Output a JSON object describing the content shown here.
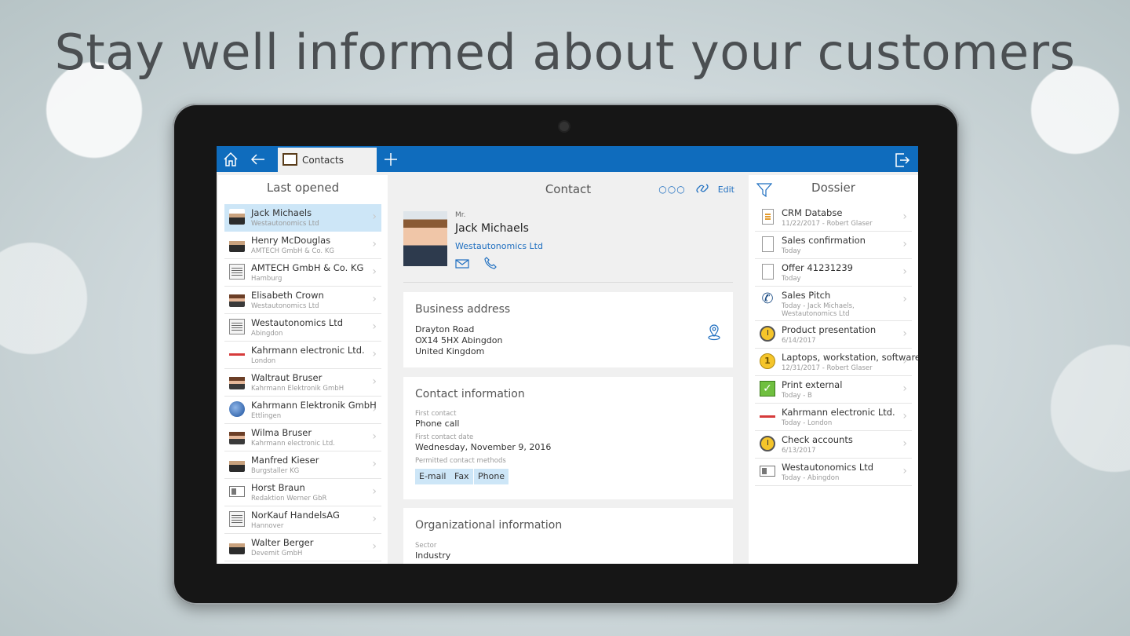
{
  "headline": "Stay well informed about your customers",
  "topbar": {
    "home_icon": "home-icon",
    "back_icon": "back-arrow-icon",
    "tab_label": "Contacts",
    "add_icon": "plus-icon",
    "exit_icon": "exit-icon",
    "accent": "#0f6cbd"
  },
  "last_opened": {
    "title": "Last opened",
    "items": [
      {
        "name": "Jack Michaels",
        "sub": "Westautonomics Ltd",
        "icon": "avatar-icon"
      },
      {
        "name": "Henry McDouglas",
        "sub": "AMTECH GmbH & Co. KG",
        "icon": "avatar-icon"
      },
      {
        "name": "AMTECH GmbH & Co. KG",
        "sub": "Hamburg",
        "icon": "building-icon"
      },
      {
        "name": "Elisabeth Crown",
        "sub": "Westautonomics Ltd",
        "icon": "avatar-icon"
      },
      {
        "name": "Westautonomics Ltd",
        "sub": "Abingdon",
        "icon": "building-icon"
      },
      {
        "name": "Kahrmann electronic Ltd.",
        "sub": "London",
        "icon": "company-logo-icon"
      },
      {
        "name": "Waltraut Bruser",
        "sub": "Kahrmann Elektronik GmbH",
        "icon": "avatar-icon"
      },
      {
        "name": "Kahrmann Elektronik GmbH",
        "sub": "Ettlingen",
        "icon": "globe-icon"
      },
      {
        "name": "Wilma Bruser",
        "sub": "Kahrmann electronic Ltd.",
        "icon": "avatar-icon"
      },
      {
        "name": "Manfred Kieser",
        "sub": "Burgstaller KG",
        "icon": "avatar-icon"
      },
      {
        "name": "Horst Braun",
        "sub": "Redaktion Werner GbR",
        "icon": "id-card-icon"
      },
      {
        "name": "NorKauf HandelsAG",
        "sub": "Hannover",
        "icon": "building-icon"
      },
      {
        "name": "Walter Berger",
        "sub": "Devemit GmbH",
        "icon": "avatar-icon"
      }
    ]
  },
  "contact": {
    "title": "Contact",
    "edit_label": "Edit",
    "salutation": "Mr.",
    "name": "Jack Michaels",
    "company": "Westautonomics Ltd",
    "business_address": {
      "title": "Business address",
      "line1": "Drayton Road",
      "line2": "OX14 5HX Abingdon",
      "line3": "United Kingdom"
    },
    "contact_information": {
      "title": "Contact information",
      "first_contact_label": "First contact",
      "first_contact": "Phone call",
      "first_contact_date_label": "First contact date",
      "first_contact_date": "Wednesday, November 9, 2016",
      "methods_label": "Permitted contact methods",
      "methods": [
        "E-mail",
        "Fax",
        "Phone"
      ]
    },
    "organizational_information": {
      "title": "Organizational information",
      "sector_label": "Sector",
      "sector": "Industry"
    }
  },
  "dossier": {
    "title": "Dossier",
    "items": [
      {
        "name": "CRM Databse",
        "sub": "11/22/2017 - Robert Glaser",
        "icon": "document-icon"
      },
      {
        "name": "Sales confirmation",
        "sub": "Today",
        "icon": "document-icon"
      },
      {
        "name": "Offer 41231239",
        "sub": "Today",
        "icon": "document-icon"
      },
      {
        "name": "Sales Pitch",
        "sub": "Today - Jack Michaels, Westautonomics Ltd",
        "icon": "phone-icon"
      },
      {
        "name": "Product presentation",
        "sub": "6/14/2017",
        "icon": "clock-icon"
      },
      {
        "name": "Laptops, workstation, software",
        "sub": "12/31/2017 - Robert Glaser",
        "icon": "coin-icon"
      },
      {
        "name": "Print external",
        "sub": "Today - B",
        "icon": "checklist-icon"
      },
      {
        "name": "Kahrmann electronic Ltd.",
        "sub": "Today - London",
        "icon": "company-logo-icon"
      },
      {
        "name": "Check accounts",
        "sub": "6/13/2017",
        "icon": "clock-icon"
      },
      {
        "name": "Westautonomics Ltd",
        "sub": "Today - Abingdon",
        "icon": "id-card-icon"
      }
    ]
  }
}
